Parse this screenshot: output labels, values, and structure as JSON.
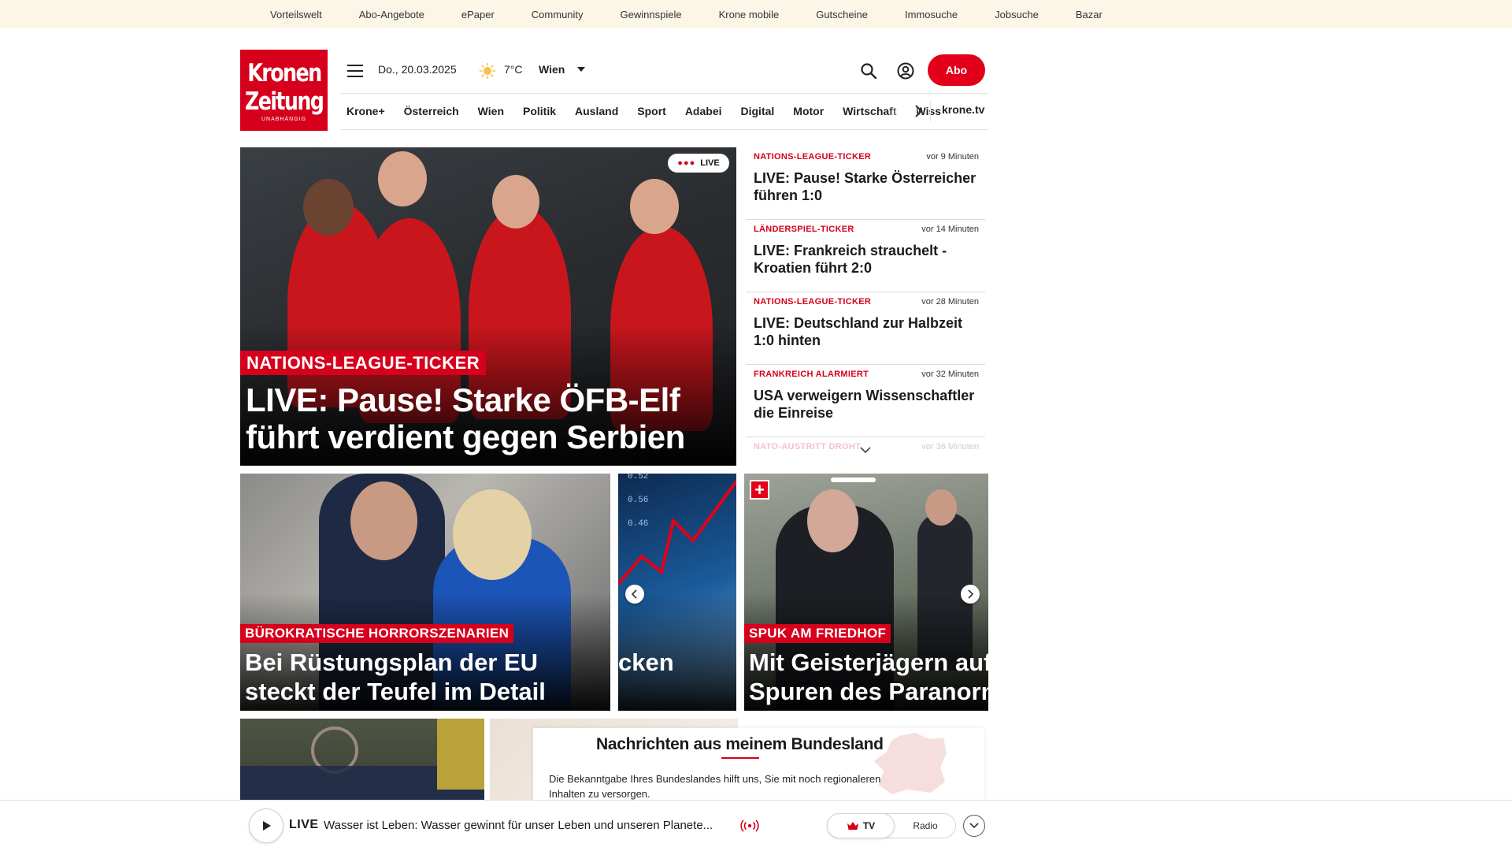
{
  "topbar": {
    "links": [
      "Vorteilswelt",
      "Abo-Angebote",
      "ePaper",
      "Community",
      "Gewinnspiele",
      "Krone mobile",
      "Gutscheine",
      "Immosuche",
      "Jobsuche",
      "Bazar"
    ]
  },
  "header": {
    "logo_line1": "Kronen",
    "logo_line2": "Zeitung",
    "logo_line3": "UNABHÄNGIG",
    "date": "Do., 20.03.2025",
    "temperature": "7°C",
    "city": "Wien",
    "abo_label": "Abo",
    "weather_icon": "sun-icon"
  },
  "nav": {
    "items": [
      "Krone+",
      "Österreich",
      "Wien",
      "Politik",
      "Ausland",
      "Sport",
      "Adabei",
      "Digital",
      "Motor",
      "Wirtschaft",
      "Wiss"
    ],
    "tv_link": "krone.tv"
  },
  "hero": {
    "live_badge": "LIVE",
    "tag": "NATIONS-LEAGUE-TICKER",
    "title_line1": "LIVE: Pause! Starke ÖFB-Elf",
    "title_line2": "führt verdient gegen Serbien"
  },
  "ticker": {
    "items": [
      {
        "category": "NATIONS-LEAGUE-TICKER",
        "time": "vor 9 Minuten",
        "title": "LIVE: Pause! Starke Österreicher führen 1:0"
      },
      {
        "category": "LÄNDERSPIEL-TICKER",
        "time": "vor 14 Minuten",
        "title": "LIVE: Frankreich strauchelt - Kroatien führt 2:0"
      },
      {
        "category": "NATIONS-LEAGUE-TICKER",
        "time": "vor 28 Minuten",
        "title": "LIVE: Deutschland zur Halbzeit 1:0 hinten"
      },
      {
        "category": "FRANKREICH ALARMIERT",
        "time": "vor 32 Minuten",
        "title": "USA verweigern Wissenschaftler die Einreise"
      },
      {
        "category": "NATO-AUSTRITT DROHT",
        "time": "vor 36 Minuten",
        "title": ""
      }
    ]
  },
  "slider": {
    "cards": [
      {
        "tag": "BÜROKRATISCHE HORRORSZENARIEN",
        "title_line1": "Bei Rüstungsplan der EU",
        "title_line2": "steckt der Teufel im Detail"
      },
      {
        "tag": "",
        "title_line1": "",
        "title_line2": "cken"
      },
      {
        "tag": "SPUK AM FRIEDHOF",
        "title_line1": "Mit Geisterjägern auf",
        "title_line2": "Spuren des Paranorm"
      }
    ],
    "chart_labels": [
      "0.52",
      "0.56",
      "0.46"
    ],
    "plus_badge": "+"
  },
  "bundesland": {
    "title": "Nachrichten aus meinem Bundesland",
    "text": "Die Bekanntgabe Ihres Bundeslandes hilft uns, Sie mit noch regionaleren Inhalten zu versorgen."
  },
  "livebar": {
    "label": "LIVE",
    "text": "Wasser ist Leben: Wasser gewinnt für unser Leben und unseren Planete...",
    "tv_label": "TV",
    "radio_label": "Radio"
  },
  "colors": {
    "brand_red": "#d6001c",
    "topbar_bg": "#fbf6e6"
  }
}
